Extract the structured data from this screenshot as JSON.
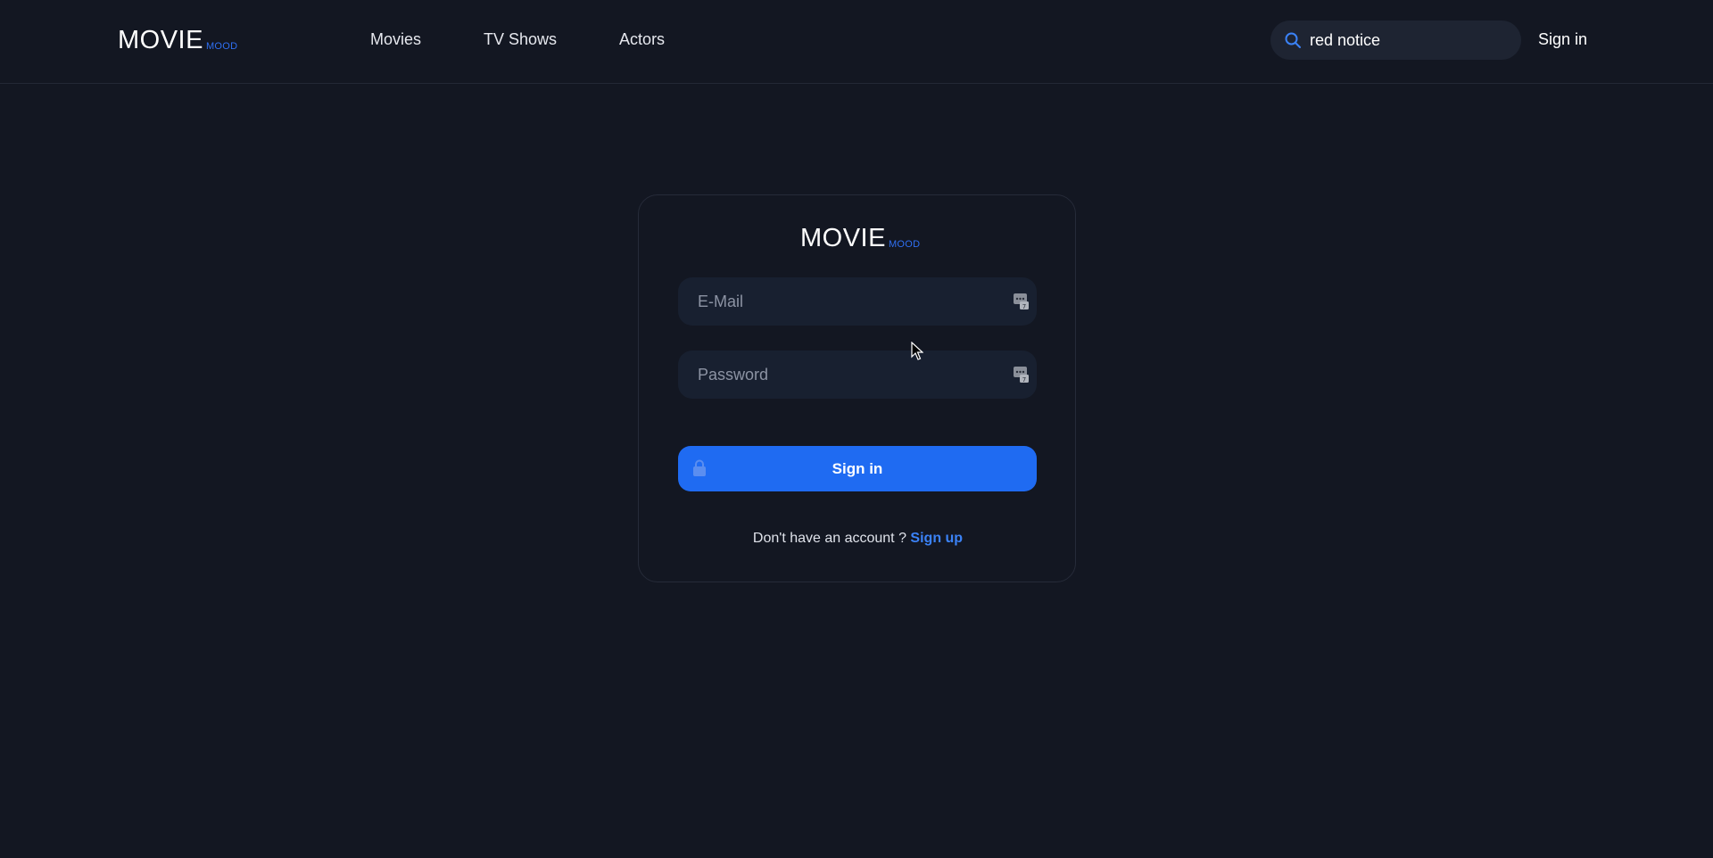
{
  "header": {
    "logo": {
      "main": "MOVIE",
      "sub": "MOOD"
    },
    "nav": [
      {
        "label": "Movies"
      },
      {
        "label": "TV Shows"
      },
      {
        "label": "Actors"
      }
    ],
    "search": {
      "value": "red notice",
      "icon": "search-icon"
    },
    "signin_label": "Sign in"
  },
  "login": {
    "logo": {
      "main": "MOVIE",
      "sub": "MOOD"
    },
    "email_placeholder": "E-Mail",
    "password_placeholder": "Password",
    "field_icon": "password-manager-key-icon",
    "submit_label": "Sign in",
    "submit_icon": "lock-icon",
    "signup_prompt": "Don't have an account ?",
    "signup_link": "Sign up"
  },
  "colors": {
    "background": "#131722",
    "accent": "#1f6bf2",
    "link": "#3b82f6",
    "field_bg": "#182030"
  }
}
